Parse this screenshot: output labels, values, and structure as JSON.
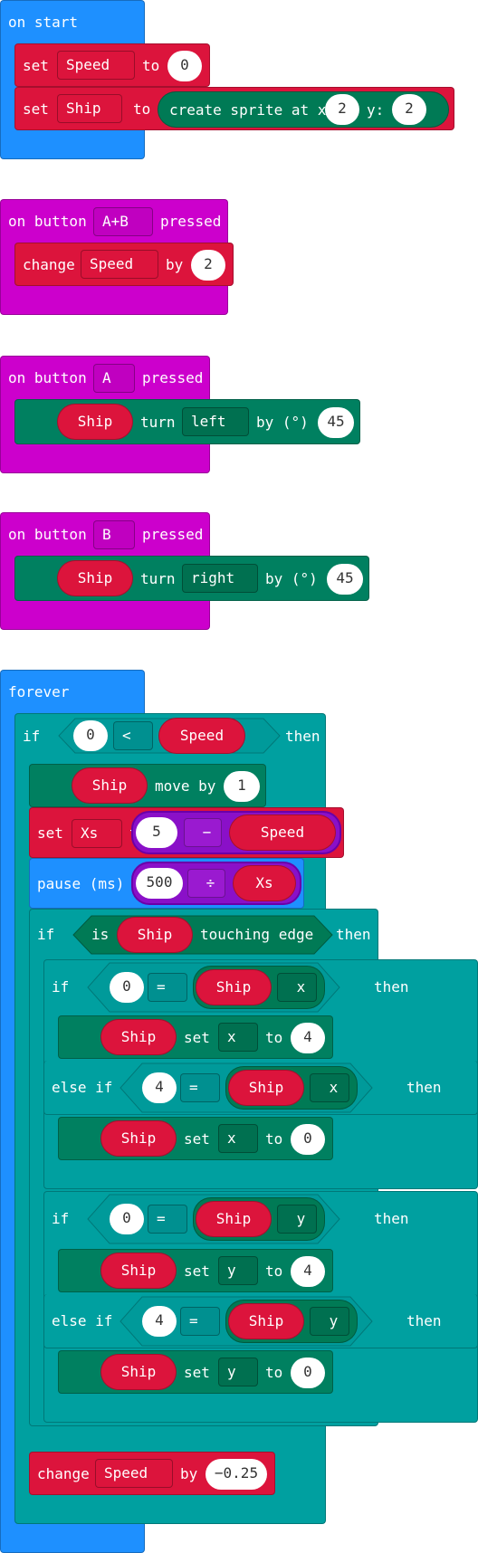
{
  "on_start": {
    "label": "on start",
    "set1": {
      "set": "set",
      "var": "Speed",
      "to": "to",
      "value": "0"
    },
    "set2": {
      "set": "set",
      "var": "Ship",
      "to": "to",
      "create": "create sprite at x:",
      "x": "2",
      "y_label": "y:",
      "y": "2"
    }
  },
  "on_ab": {
    "on": "on button",
    "btn": "A+B",
    "pressed": "pressed",
    "change": {
      "label": "change",
      "var": "Speed",
      "by": "by",
      "value": "2"
    }
  },
  "on_a": {
    "on": "on button",
    "btn": "A",
    "pressed": "pressed",
    "turn": {
      "sprite": "Ship",
      "turn": "turn",
      "dir": "left",
      "by": "by (°)",
      "value": "45"
    }
  },
  "on_b": {
    "on": "on button",
    "btn": "B",
    "pressed": "pressed",
    "turn": {
      "sprite": "Ship",
      "turn": "turn",
      "dir": "right",
      "by": "by (°)",
      "value": "45"
    }
  },
  "forever": {
    "label": "forever",
    "if1": {
      "if": "if",
      "left": "0",
      "op": "<",
      "right": "Speed",
      "then": "then"
    },
    "move": {
      "sprite": "Ship",
      "label": "move by",
      "value": "1"
    },
    "setxs": {
      "set": "set",
      "var": "Xs",
      "to": "to",
      "a": "5",
      "op": "−",
      "b": "Speed"
    },
    "pause": {
      "label": "pause (ms)",
      "a": "500",
      "op": "÷",
      "b": "Xs"
    },
    "if2": {
      "if": "if",
      "is": "is",
      "sprite": "Ship",
      "touching": "touching edge",
      "then": "then"
    },
    "ifx": {
      "if": "if",
      "left": "0",
      "op": "=",
      "sprite": "Ship",
      "prop": "x",
      "then": "then",
      "set": {
        "sprite": "Ship",
        "set": "set",
        "prop": "x",
        "to": "to",
        "value": "4"
      }
    },
    "elsex": {
      "else_if": "else if",
      "left": "4",
      "op": "=",
      "sprite": "Ship",
      "prop": "x",
      "then": "then",
      "set": {
        "sprite": "Ship",
        "set": "set",
        "prop": "x",
        "to": "to",
        "value": "0"
      }
    },
    "ify": {
      "if": "if",
      "left": "0",
      "op": "=",
      "sprite": "Ship",
      "prop": "y",
      "then": "then",
      "set": {
        "sprite": "Ship",
        "set": "set",
        "prop": "y",
        "to": "to",
        "value": "4"
      }
    },
    "elsey": {
      "else_if": "else if",
      "left": "4",
      "op": "=",
      "sprite": "Ship",
      "prop": "y",
      "then": "then",
      "set": {
        "sprite": "Ship",
        "set": "set",
        "prop": "y",
        "to": "to",
        "value": "0"
      }
    },
    "change": {
      "label": "change",
      "var": "Speed",
      "by": "by",
      "value": "−0.25"
    }
  },
  "colors": {
    "loops": "#1e90ff",
    "input": "#cc00cc",
    "variables": "#dc143c",
    "sprites": "#008060",
    "logic": "#00a0a0",
    "math": "#8a10c8"
  }
}
